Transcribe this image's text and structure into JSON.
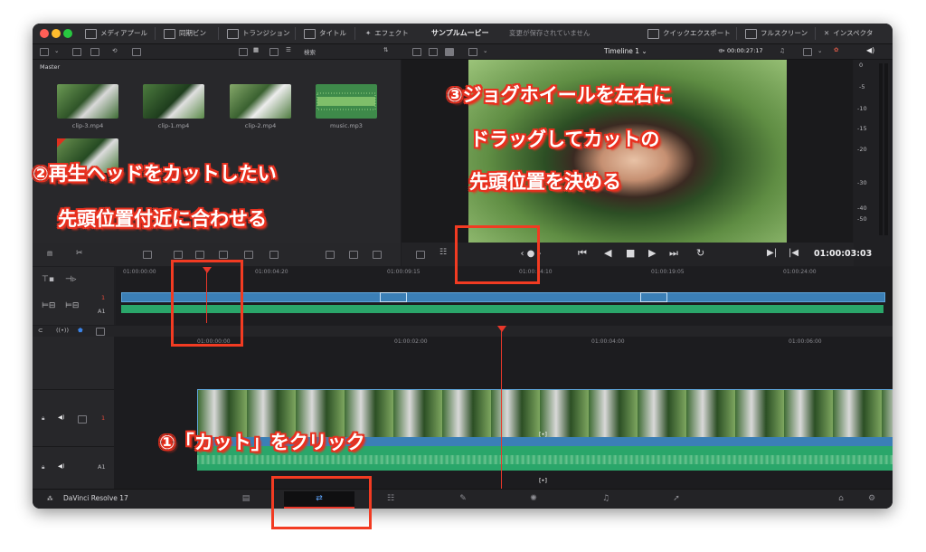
{
  "titlebar": {
    "items": [
      "メディアプール",
      "同期ビン",
      "トランジション",
      "タイトル",
      "エフェクト"
    ],
    "project_title": "サンプルムービー",
    "status": "変更が保存されていません",
    "right_items": [
      "クイックエクスポート",
      "フルスクリーン",
      "インスペクタ"
    ]
  },
  "toolbar": {
    "search_label": "検索",
    "timeline_name": "Timeline 1",
    "duration": "00:00:27:17"
  },
  "media_pool": {
    "bin": "Master",
    "clips": [
      {
        "name": "clip-3.mp4"
      },
      {
        "name": "clip-1.mp4"
      },
      {
        "name": "clip-2.mp4"
      },
      {
        "name": "music.mp3"
      }
    ]
  },
  "viewer": {
    "timecode": "01:00:03:03"
  },
  "audio_meter": {
    "scale": [
      "0",
      "-5",
      "-10",
      "-15",
      "-20",
      "-30",
      "-40",
      "-50"
    ]
  },
  "upper_timeline": {
    "ticks": [
      "01:00:00:00",
      "01:00:04:20",
      "01:00:09:15",
      "01:00:14:10",
      "01:00:19:05",
      "01:00:24:00"
    ],
    "track_labels": [
      "1",
      "A1"
    ]
  },
  "lower_timeline": {
    "ticks": [
      "01:00:00:00",
      "01:00:02:00",
      "01:00:04:00",
      "01:00:06:00"
    ],
    "track_labels": [
      "1",
      "A1"
    ]
  },
  "footer": {
    "app_name": "DaVinci Resolve 17"
  },
  "annotations": {
    "step1": "①「カット」をクリック",
    "step2_line1": "②再生ヘッドをカットしたい",
    "step2_line2": "先頭位置付近に合わせる",
    "step3_line1": "③ジョグホイールを左右に",
    "step3_line2": "ドラッグしてカットの",
    "step3_line3": "先頭位置を決める"
  },
  "colors": {
    "video_track": "#3b7fb6",
    "audio_track": "#2aa66a",
    "playhead": "#e8372a",
    "annotation_red": "#f23b22"
  }
}
